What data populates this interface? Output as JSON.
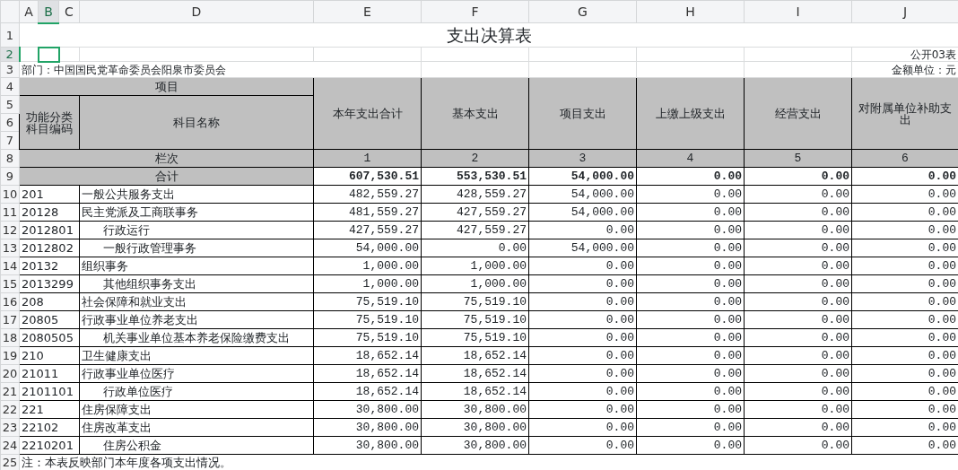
{
  "column_headers": [
    {
      "label": "A",
      "selected": false
    },
    {
      "label": "B",
      "selected": true
    },
    {
      "label": "C",
      "selected": false
    },
    {
      "label": "D",
      "selected": false
    },
    {
      "label": "E",
      "selected": false
    },
    {
      "label": "F",
      "selected": false
    },
    {
      "label": "G",
      "selected": false
    },
    {
      "label": "H",
      "selected": false
    },
    {
      "label": "I",
      "selected": false
    },
    {
      "label": "J",
      "selected": false
    }
  ],
  "row_headers": [
    {
      "label": "1",
      "selected": false
    },
    {
      "label": "2",
      "selected": true
    },
    {
      "label": "3",
      "selected": false
    },
    {
      "label": "4",
      "selected": false
    },
    {
      "label": "5",
      "selected": false
    },
    {
      "label": "6",
      "selected": false
    },
    {
      "label": "7",
      "selected": false
    },
    {
      "label": "8",
      "selected": false
    },
    {
      "label": "9",
      "selected": false
    },
    {
      "label": "10",
      "selected": false
    },
    {
      "label": "11",
      "selected": false
    },
    {
      "label": "12",
      "selected": false
    },
    {
      "label": "13",
      "selected": false
    },
    {
      "label": "14",
      "selected": false
    },
    {
      "label": "15",
      "selected": false
    },
    {
      "label": "16",
      "selected": false
    },
    {
      "label": "17",
      "selected": false
    },
    {
      "label": "18",
      "selected": false
    },
    {
      "label": "19",
      "selected": false
    },
    {
      "label": "20",
      "selected": false
    },
    {
      "label": "21",
      "selected": false
    },
    {
      "label": "22",
      "selected": false
    },
    {
      "label": "23",
      "selected": false
    },
    {
      "label": "24",
      "selected": false
    },
    {
      "label": "25",
      "selected": false
    }
  ],
  "title": "支出决算表",
  "form_number": "公开03表",
  "department": "部门：中国国民党革命委员会阳泉市委员会",
  "unit": "金额单位：元",
  "header": {
    "group": "项目",
    "code_label": "功能分类科目编码",
    "name_label": "科目名称",
    "index_label": "栏次",
    "columns": [
      "本年支出合计",
      "基本支出",
      "项目支出",
      "上缴上级支出",
      "经营支出",
      "对附属单位补助支出"
    ],
    "column_numbers": [
      "1",
      "2",
      "3",
      "4",
      "5",
      "6"
    ]
  },
  "total": {
    "label": "合计",
    "values": [
      "607,530.51",
      "553,530.51",
      "54,000.00",
      "0.00",
      "0.00",
      "0.00"
    ]
  },
  "rows": [
    {
      "code": "201",
      "name": "一般公共服务支出",
      "values": [
        "482,559.27",
        "428,559.27",
        "54,000.00",
        "0.00",
        "0.00",
        "0.00"
      ]
    },
    {
      "code": "20128",
      "name": "民主党派及工商联事务",
      "values": [
        "481,559.27",
        "427,559.27",
        "54,000.00",
        "0.00",
        "0.00",
        "0.00"
      ],
      "children": [
        {
          "code": "2012801",
          "name": "行政运行",
          "values": [
            "427,559.27",
            "427,559.27",
            "0.00",
            "0.00",
            "0.00",
            "0.00"
          ]
        },
        {
          "code": "2012802",
          "name": "一般行政管理事务",
          "values": [
            "54,000.00",
            "0.00",
            "54,000.00",
            "0.00",
            "0.00",
            "0.00"
          ]
        }
      ]
    },
    {
      "code": "20132",
      "name": "组织事务",
      "values": [
        "1,000.00",
        "1,000.00",
        "0.00",
        "0.00",
        "0.00",
        "0.00"
      ],
      "children": [
        {
          "code": "2013299",
          "name": "其他组织事务支出",
          "values": [
            "1,000.00",
            "1,000.00",
            "0.00",
            "0.00",
            "0.00",
            "0.00"
          ]
        }
      ]
    },
    {
      "code": "208",
      "name": "社会保障和就业支出",
      "values": [
        "75,519.10",
        "75,519.10",
        "0.00",
        "0.00",
        "0.00",
        "0.00"
      ]
    },
    {
      "code": "20805",
      "name": "行政事业单位养老支出",
      "values": [
        "75,519.10",
        "75,519.10",
        "0.00",
        "0.00",
        "0.00",
        "0.00"
      ],
      "children": [
        {
          "code": "2080505",
          "name": "机关事业单位基本养老保险缴费支出",
          "values": [
            "75,519.10",
            "75,519.10",
            "0.00",
            "0.00",
            "0.00",
            "0.00"
          ]
        }
      ]
    },
    {
      "code": "210",
      "name": "卫生健康支出",
      "values": [
        "18,652.14",
        "18,652.14",
        "0.00",
        "0.00",
        "0.00",
        "0.00"
      ]
    },
    {
      "code": "21011",
      "name": "行政事业单位医疗",
      "values": [
        "18,652.14",
        "18,652.14",
        "0.00",
        "0.00",
        "0.00",
        "0.00"
      ],
      "children": [
        {
          "code": "2101101",
          "name": "行政单位医疗",
          "values": [
            "18,652.14",
            "18,652.14",
            "0.00",
            "0.00",
            "0.00",
            "0.00"
          ]
        }
      ]
    },
    {
      "code": "221",
      "name": "住房保障支出",
      "values": [
        "30,800.00",
        "30,800.00",
        "0.00",
        "0.00",
        "0.00",
        "0.00"
      ]
    },
    {
      "code": "22102",
      "name": "住房改革支出",
      "values": [
        "30,800.00",
        "30,800.00",
        "0.00",
        "0.00",
        "0.00",
        "0.00"
      ],
      "children": [
        {
          "code": "2210201",
          "name": "住房公积金",
          "values": [
            "30,800.00",
            "30,800.00",
            "0.00",
            "0.00",
            "0.00",
            "0.00"
          ]
        }
      ]
    }
  ],
  "note": "注：本表反映部门本年度各项支出情况。"
}
